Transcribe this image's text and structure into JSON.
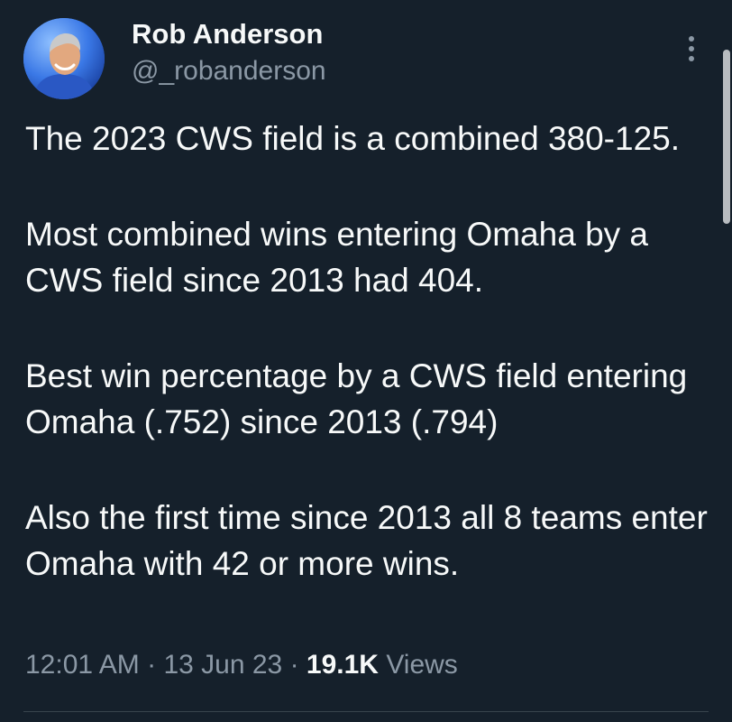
{
  "author": {
    "display_name": "Rob Anderson",
    "handle": "@_robanderson",
    "avatar": "profile-photo"
  },
  "tweet": {
    "paragraphs": [
      "The 2023 CWS field is a combined 380-125.",
      "Most combined wins entering Omaha by a CWS field since 2013 had 404.",
      "Best win percentage by a CWS field entering Omaha (.752) since 2013 (.794)",
      "Also the first time since 2013 all 8 teams enter Omaha with 42 or more wins."
    ]
  },
  "meta": {
    "time": "12:01 AM",
    "date": "13 Jun 23",
    "views_count": "19.1K",
    "views_label": "Views",
    "separator": "·"
  },
  "icons": {
    "more": "more-vertical-icon"
  },
  "colors": {
    "background": "#15202b",
    "text_primary": "#f7f9f9",
    "text_secondary": "#8b98a5"
  }
}
